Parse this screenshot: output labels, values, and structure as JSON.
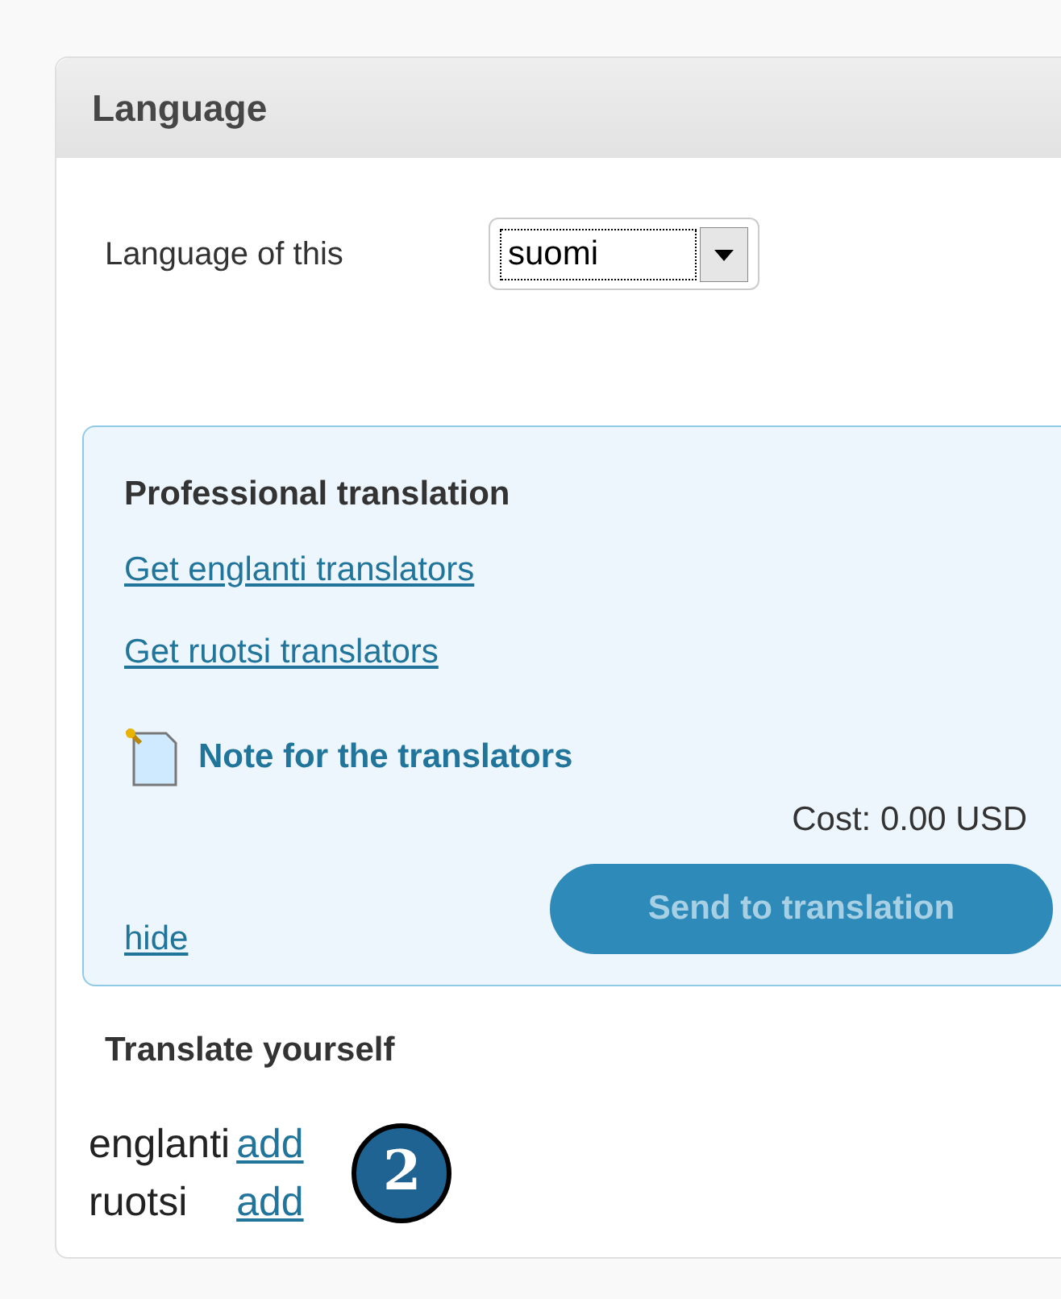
{
  "panel": {
    "title": "Language"
  },
  "language_select": {
    "label": "Language of this",
    "value": "suomi"
  },
  "professional": {
    "title": "Professional translation",
    "links": [
      "Get englanti translators",
      "Get ruotsi translators"
    ],
    "note_link": "Note for the translators",
    "cost": "Cost: 0.00 USD",
    "hide_link": "hide",
    "send_button": {
      "label": "Send to translation",
      "disabled": true
    }
  },
  "translate_yourself": {
    "title": "Translate yourself",
    "rows": [
      {
        "language": "englanti",
        "action": "add"
      },
      {
        "language": "ruotsi",
        "action": "add"
      }
    ]
  },
  "callout": {
    "number": "2"
  }
}
